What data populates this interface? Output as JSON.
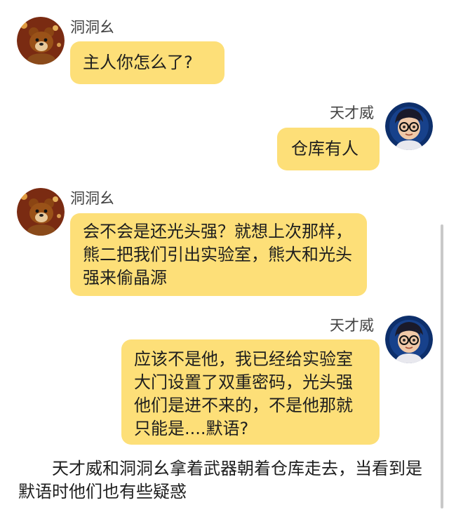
{
  "messages": [
    {
      "sender": "洞洞幺",
      "text": "主人你怎么了?",
      "avatar_icon": "bear-avatar-icon"
    },
    {
      "sender": "天才威",
      "text": "仓库有人",
      "avatar_icon": "boy-with-glasses-avatar-icon"
    },
    {
      "sender": "洞洞幺",
      "text": "会不会是还光头强？就想上次那样，熊二把我们引出实验室，熊大和光头强来偷晶源",
      "avatar_icon": "bear-avatar-icon"
    },
    {
      "sender": "天才威",
      "text": "应该不是他，我已经给实验室大门设置了双重密码，光头强他们是进不来的，不是他那就只能是....默语?",
      "avatar_icon": "boy-with-glasses-avatar-icon"
    }
  ],
  "narration": "天才威和洞洞幺拿着武器朝着仓库走去，当看到是默语时他们也有些疑惑",
  "colors": {
    "bubble": "#fddf78",
    "background": "#ffffff",
    "scrollbar": "#c9c9c9"
  }
}
